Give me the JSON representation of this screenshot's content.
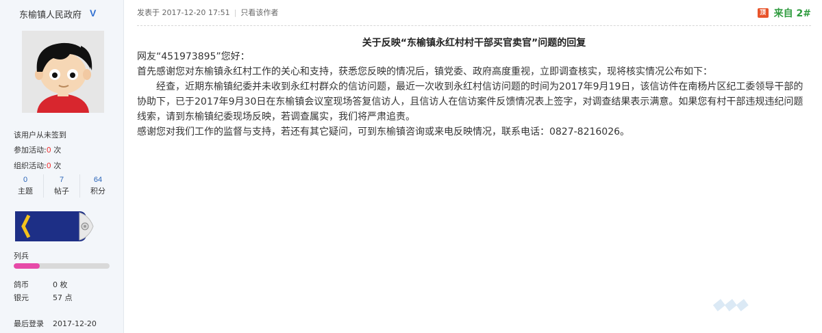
{
  "profile": {
    "name": "东榆镇人民政府",
    "verified_badge": "V",
    "checkin_status": "该用户从未签到",
    "activities_joined_label": "参加活动:",
    "activities_joined_count": "0",
    "activities_unit": "次",
    "activities_organized_label": "组织活动:",
    "activities_organized_count": "0",
    "activities_organized_unit": "次",
    "stats": [
      {
        "value": "0",
        "label": "主题"
      },
      {
        "value": "7",
        "label": "帖子"
      },
      {
        "value": "64",
        "label": "积分"
      }
    ],
    "rank_name": "列兵",
    "rank_progress_fraction": 0.27,
    "coins_label": "鸽币",
    "coins_value": "0 枚",
    "silver_label": "银元",
    "silver_value": "57 点",
    "last_login_label": "最后登录",
    "last_login_value": "2017-12-20"
  },
  "post": {
    "posted_label": "发表于 2017-12-20 17:51",
    "only_author_label": "只看该作者",
    "top_icon": "顶",
    "floor_label": "来自 2#",
    "title": "关于反映“东榆镇永红村村干部买官卖官”问题的回复",
    "paragraphs": [
      "网友“451973895”您好：",
      "首先感谢您对东榆镇永红村工作的关心和支持，获悉您反映的情况后，镇党委、政府高度重视，立即调查核实，现将核实情况公布如下：",
      "经查，近期东榆镇纪委并未收到永红村群众的信访问题，最近一次收到永红村信访问题的时间为2017年9月19日，该信访件在南杨片区纪工委领导干部的协助下，已于2017年9月30日在东榆镇会议室现场答复信访人，且信访人在信访案件反馈情况表上签字，对调查结果表示满意。如果您有村干部违规违纪问题线索，请到东榆镇纪委现场反映，若调查属实，我们将严肃追责。",
      "感谢您对我们工作的监督与支持，若还有其它疑问，可到东榆镇咨询或来电反映情况，联系电话：0827-8216026。"
    ]
  },
  "colors": {
    "accent_blue": "#2a64b8",
    "floor_green": "#2e9b3e",
    "highlight_red": "#e33",
    "rank_pink": "#e64aa8"
  }
}
